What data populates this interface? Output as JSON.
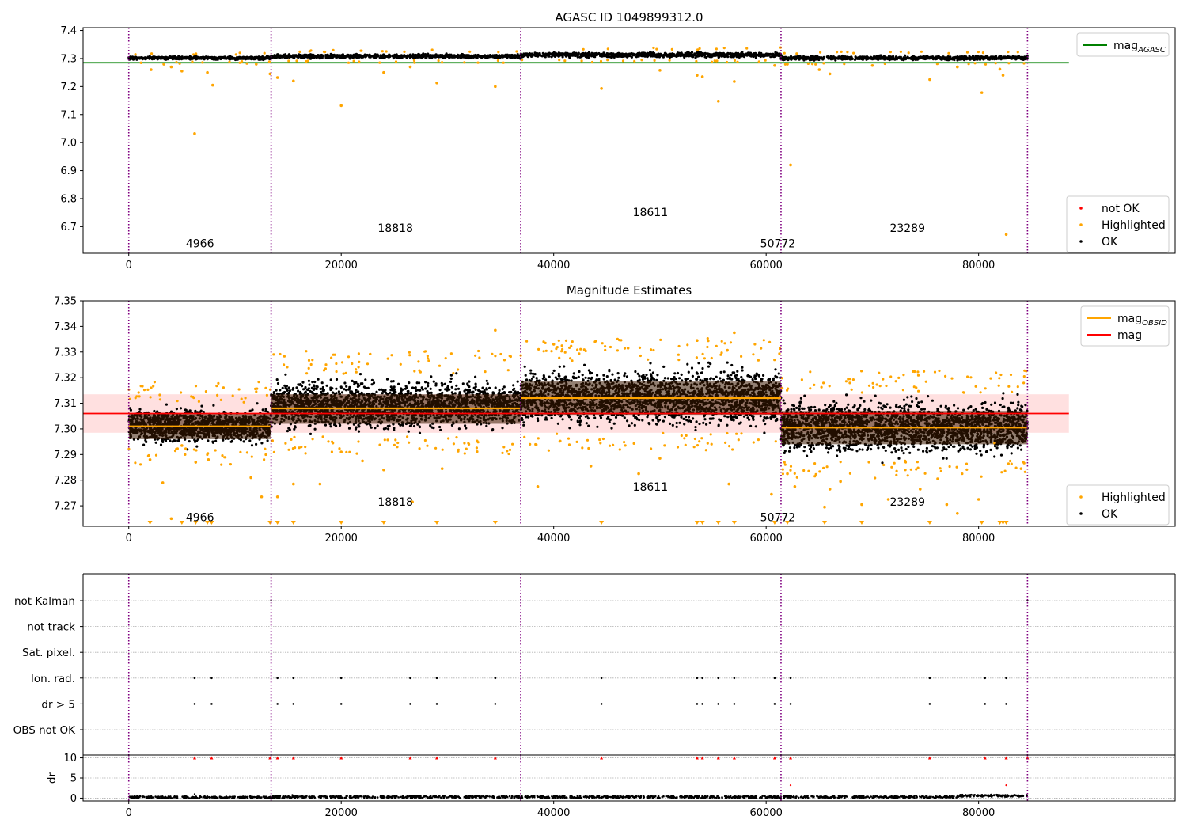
{
  "figure": {
    "title_top": "AGASC ID 1049899312.0",
    "title_mid": "Magnitude Estimates"
  },
  "chart_data": [
    {
      "type": "scatter",
      "title": "AGASC ID 1049899312.0",
      "xlim": [
        -4300,
        98500
      ],
      "ylim": [
        6.605,
        7.41
      ],
      "xticks": [
        0,
        20000,
        40000,
        60000,
        80000
      ],
      "xtick_labels": [
        "0",
        "20000",
        "40000",
        "60000",
        "80000"
      ],
      "yticks": [
        6.7,
        6.8,
        6.9,
        7.0,
        7.1,
        7.2,
        7.3,
        7.4
      ],
      "ytick_labels": [
        "6.7",
        "6.8",
        "6.9",
        "7.0",
        "7.1",
        "7.2",
        "7.3",
        "7.4"
      ],
      "mag_agasc": 7.285,
      "mag_line_xrange": [
        -4300,
        88500
      ],
      "obs_boundaries": [
        0,
        13400,
        36900,
        61400,
        84600
      ],
      "obsids": [
        {
          "label": "4966",
          "x": 6700,
          "y": 6.64
        },
        {
          "label": "18818",
          "x": 25100,
          "y": 6.695
        },
        {
          "label": "18611",
          "x": 49100,
          "y": 6.752
        },
        {
          "label": "50772",
          "x": 61100,
          "y": 6.64
        },
        {
          "label": "23289",
          "x": 73300,
          "y": 6.695
        }
      ],
      "obs_segments": [
        {
          "x0": 0,
          "x1": 13400,
          "mean": 7.302,
          "spread": 0.004
        },
        {
          "x0": 13400,
          "x1": 36900,
          "mean": 7.308,
          "spread": 0.005
        },
        {
          "x0": 36900,
          "x1": 61400,
          "mean": 7.313,
          "spread": 0.006
        },
        {
          "x0": 61400,
          "x1": 84600,
          "mean": 7.302,
          "spread": 0.005
        }
      ],
      "outliers": [
        {
          "x": 2100,
          "y": 7.26
        },
        {
          "x": 3300,
          "y": 7.28
        },
        {
          "x": 4000,
          "y": 7.27
        },
        {
          "x": 5000,
          "y": 7.255
        },
        {
          "x": 6200,
          "y": 7.032
        },
        {
          "x": 7400,
          "y": 7.25
        },
        {
          "x": 7900,
          "y": 7.205
        },
        {
          "x": 12000,
          "y": 7.28
        },
        {
          "x": 13300,
          "y": 7.245
        },
        {
          "x": 14000,
          "y": 7.232
        },
        {
          "x": 15500,
          "y": 7.22
        },
        {
          "x": 20000,
          "y": 7.132
        },
        {
          "x": 24000,
          "y": 7.25
        },
        {
          "x": 26500,
          "y": 7.27
        },
        {
          "x": 29000,
          "y": 7.213
        },
        {
          "x": 34500,
          "y": 7.2
        },
        {
          "x": 44500,
          "y": 7.193
        },
        {
          "x": 50000,
          "y": 7.258
        },
        {
          "x": 53500,
          "y": 7.24
        },
        {
          "x": 54000,
          "y": 7.235
        },
        {
          "x": 55500,
          "y": 7.148
        },
        {
          "x": 57000,
          "y": 7.218
        },
        {
          "x": 60800,
          "y": 7.275
        },
        {
          "x": 62000,
          "y": 7.28
        },
        {
          "x": 62300,
          "y": 6.92
        },
        {
          "x": 65000,
          "y": 7.26
        },
        {
          "x": 66000,
          "y": 7.245
        },
        {
          "x": 70000,
          "y": 7.275
        },
        {
          "x": 75400,
          "y": 7.225
        },
        {
          "x": 78000,
          "y": 7.27
        },
        {
          "x": 80300,
          "y": 7.178
        },
        {
          "x": 82000,
          "y": 7.262
        },
        {
          "x": 82300,
          "y": 7.24
        },
        {
          "x": 82600,
          "y": 6.672
        }
      ],
      "legend_upper": [
        {
          "label": "mag",
          "subscript": "AGASC",
          "color": "#008000"
        }
      ],
      "legend_lower": [
        {
          "label": "not OK",
          "color": "#ff0000"
        },
        {
          "label": "Highlighted",
          "color": "#ffa500"
        },
        {
          "label": "OK",
          "color": "#000000"
        }
      ]
    },
    {
      "type": "scatter",
      "title": "Magnitude Estimates",
      "xlim": [
        -4300,
        98500
      ],
      "ylim": [
        7.262,
        7.35
      ],
      "xticks": [
        0,
        20000,
        40000,
        60000,
        80000
      ],
      "xtick_labels": [
        "0",
        "20000",
        "40000",
        "60000",
        "80000"
      ],
      "yticks": [
        7.27,
        7.28,
        7.29,
        7.3,
        7.31,
        7.32,
        7.33,
        7.34,
        7.35
      ],
      "ytick_labels": [
        "7.27",
        "7.28",
        "7.29",
        "7.30",
        "7.31",
        "7.32",
        "7.33",
        "7.34",
        "7.35"
      ],
      "mag": 7.306,
      "mag_band": [
        7.2985,
        7.3135
      ],
      "mag_line_xrange": [
        -4300,
        88500
      ],
      "obs_boundaries": [
        0,
        13400,
        36900,
        61400,
        84600
      ],
      "obsids": [
        {
          "label": "4966",
          "x": 6700,
          "y": 7.2655
        },
        {
          "label": "18818",
          "x": 25100,
          "y": 7.2715
        },
        {
          "label": "18611",
          "x": 49100,
          "y": 7.2775
        },
        {
          "label": "50772",
          "x": 61100,
          "y": 7.2655
        },
        {
          "label": "23289",
          "x": 73300,
          "y": 7.2715
        }
      ],
      "obs_segments": [
        {
          "x0": 0,
          "x1": 13400,
          "mag_obsid": 7.301,
          "band": [
            7.296,
            7.306
          ],
          "y_lo": 7.2925,
          "y_hi": 7.31
        },
        {
          "x0": 13400,
          "x1": 36900,
          "mag_obsid": 7.308,
          "band": [
            7.302,
            7.3135
          ],
          "y_lo": 7.297,
          "y_hi": 7.3215
        },
        {
          "x0": 36900,
          "x1": 61400,
          "mag_obsid": 7.312,
          "band": [
            7.3055,
            7.3185
          ],
          "y_lo": 7.2985,
          "y_hi": 7.3265
        },
        {
          "x0": 61400,
          "x1": 84600,
          "mag_obsid": 7.3005,
          "band": [
            7.294,
            7.307
          ],
          "y_lo": 7.2875,
          "y_hi": 7.314
        }
      ],
      "highlighted_points": [
        {
          "x": 2000,
          "y": 7.288
        },
        {
          "x": 3200,
          "y": 7.279
        },
        {
          "x": 4000,
          "y": 7.265
        },
        {
          "x": 5000,
          "y": 7.2935
        },
        {
          "x": 6300,
          "y": 7.287
        },
        {
          "x": 7500,
          "y": 7.288
        },
        {
          "x": 11500,
          "y": 7.281
        },
        {
          "x": 12500,
          "y": 7.2735
        },
        {
          "x": 14000,
          "y": 7.2735
        },
        {
          "x": 15500,
          "y": 7.2785
        },
        {
          "x": 18000,
          "y": 7.2785
        },
        {
          "x": 20000,
          "y": 7.291
        },
        {
          "x": 22000,
          "y": 7.2875
        },
        {
          "x": 24000,
          "y": 7.284
        },
        {
          "x": 26700,
          "y": 7.2715
        },
        {
          "x": 29500,
          "y": 7.2845
        },
        {
          "x": 34500,
          "y": 7.3385
        },
        {
          "x": 38500,
          "y": 7.2775
        },
        {
          "x": 40000,
          "y": 7.333
        },
        {
          "x": 43500,
          "y": 7.2855
        },
        {
          "x": 47000,
          "y": 7.3315
        },
        {
          "x": 48000,
          "y": 7.2825
        },
        {
          "x": 50000,
          "y": 7.2885
        },
        {
          "x": 53500,
          "y": 7.3345
        },
        {
          "x": 56500,
          "y": 7.2785
        },
        {
          "x": 57000,
          "y": 7.3375
        },
        {
          "x": 60500,
          "y": 7.2745
        },
        {
          "x": 62000,
          "y": 7.2825
        },
        {
          "x": 62700,
          "y": 7.2775
        },
        {
          "x": 65500,
          "y": 7.2695
        },
        {
          "x": 66000,
          "y": 7.2765
        },
        {
          "x": 67000,
          "y": 7.2795
        },
        {
          "x": 69000,
          "y": 7.2705
        },
        {
          "x": 71500,
          "y": 7.2725
        },
        {
          "x": 74500,
          "y": 7.2765
        },
        {
          "x": 77000,
          "y": 7.2705
        },
        {
          "x": 78000,
          "y": 7.267
        },
        {
          "x": 80000,
          "y": 7.2725
        },
        {
          "x": 81500,
          "y": 7.2945
        },
        {
          "x": 84000,
          "y": 7.2845
        }
      ],
      "offscale_markers_x": [
        2000,
        5000,
        6300,
        7400,
        7800,
        13300,
        14000,
        15500,
        20000,
        24000,
        29000,
        34500,
        44500,
        53500,
        54000,
        55500,
        57000,
        60800,
        62000,
        65500,
        69000,
        75400,
        80300,
        82000,
        82300,
        82600
      ],
      "legend_upper": [
        {
          "label": "mag",
          "subscript": "OBSID",
          "color": "#ffa500"
        },
        {
          "label": "mag",
          "subscript": "",
          "color": "#ff0000"
        }
      ],
      "legend_lower": [
        {
          "label": "Highlighted",
          "color": "#ffa500"
        },
        {
          "label": "OK",
          "color": "#000000"
        }
      ]
    },
    {
      "type": "scatter",
      "title": "",
      "xlim": [
        -4300,
        98500
      ],
      "xticks": [
        0,
        20000,
        40000,
        60000,
        80000
      ],
      "xtick_labels": [
        "0",
        "20000",
        "40000",
        "60000",
        "80000"
      ],
      "flag_rows": [
        "not Kalman",
        "not track",
        "Sat. pixel.",
        "Ion. rad.",
        "dr > 5",
        "OBS not OK"
      ],
      "obs_boundaries": [
        0,
        13400,
        36900,
        61400,
        84600
      ],
      "ion_rad_times": [
        6200,
        7800,
        14000,
        15500,
        20000,
        26500,
        29000,
        34500,
        44500,
        53500,
        54000,
        55500,
        57000,
        60800,
        62300,
        75400,
        80600,
        82600
      ],
      "dr_gt5_times": [
        6200,
        7800,
        14000,
        15500,
        20000,
        26500,
        29000,
        34500,
        44500,
        53500,
        54000,
        55500,
        57000,
        60800,
        62300,
        75400,
        80600,
        82600
      ],
      "not_kalman_times": [
        13400,
        84600
      ],
      "dr_panel": {
        "ylabel": "dr",
        "ylim": [
          -0.7,
          10.7
        ],
        "yticks": [
          0,
          5,
          10
        ],
        "ytick_labels": [
          "0",
          "5",
          "10"
        ],
        "clipped_times": [
          6200,
          7800,
          13300,
          14000,
          15500,
          20000,
          26500,
          29000,
          34500,
          44500,
          53500,
          54000,
          55500,
          57000,
          60800,
          62300,
          75400,
          80600,
          82600,
          84600
        ],
        "clipped_value": 10,
        "extra_points": [
          {
            "x": 62300,
            "y": 3.2
          },
          {
            "x": 82600,
            "y": 3.2
          },
          {
            "x": 6200,
            "y": 1.0
          },
          {
            "x": 15400,
            "y": 0.8
          }
        ],
        "segments": [
          {
            "x0": 0,
            "x1": 13400,
            "base": 0.2
          },
          {
            "x0": 13400,
            "x1": 36900,
            "base": 0.3
          },
          {
            "x0": 36900,
            "x1": 61400,
            "base": 0.3
          },
          {
            "x0": 61400,
            "x1": 78000,
            "base": 0.3
          },
          {
            "x0": 78000,
            "x1": 84600,
            "base": 0.6
          }
        ]
      }
    }
  ]
}
